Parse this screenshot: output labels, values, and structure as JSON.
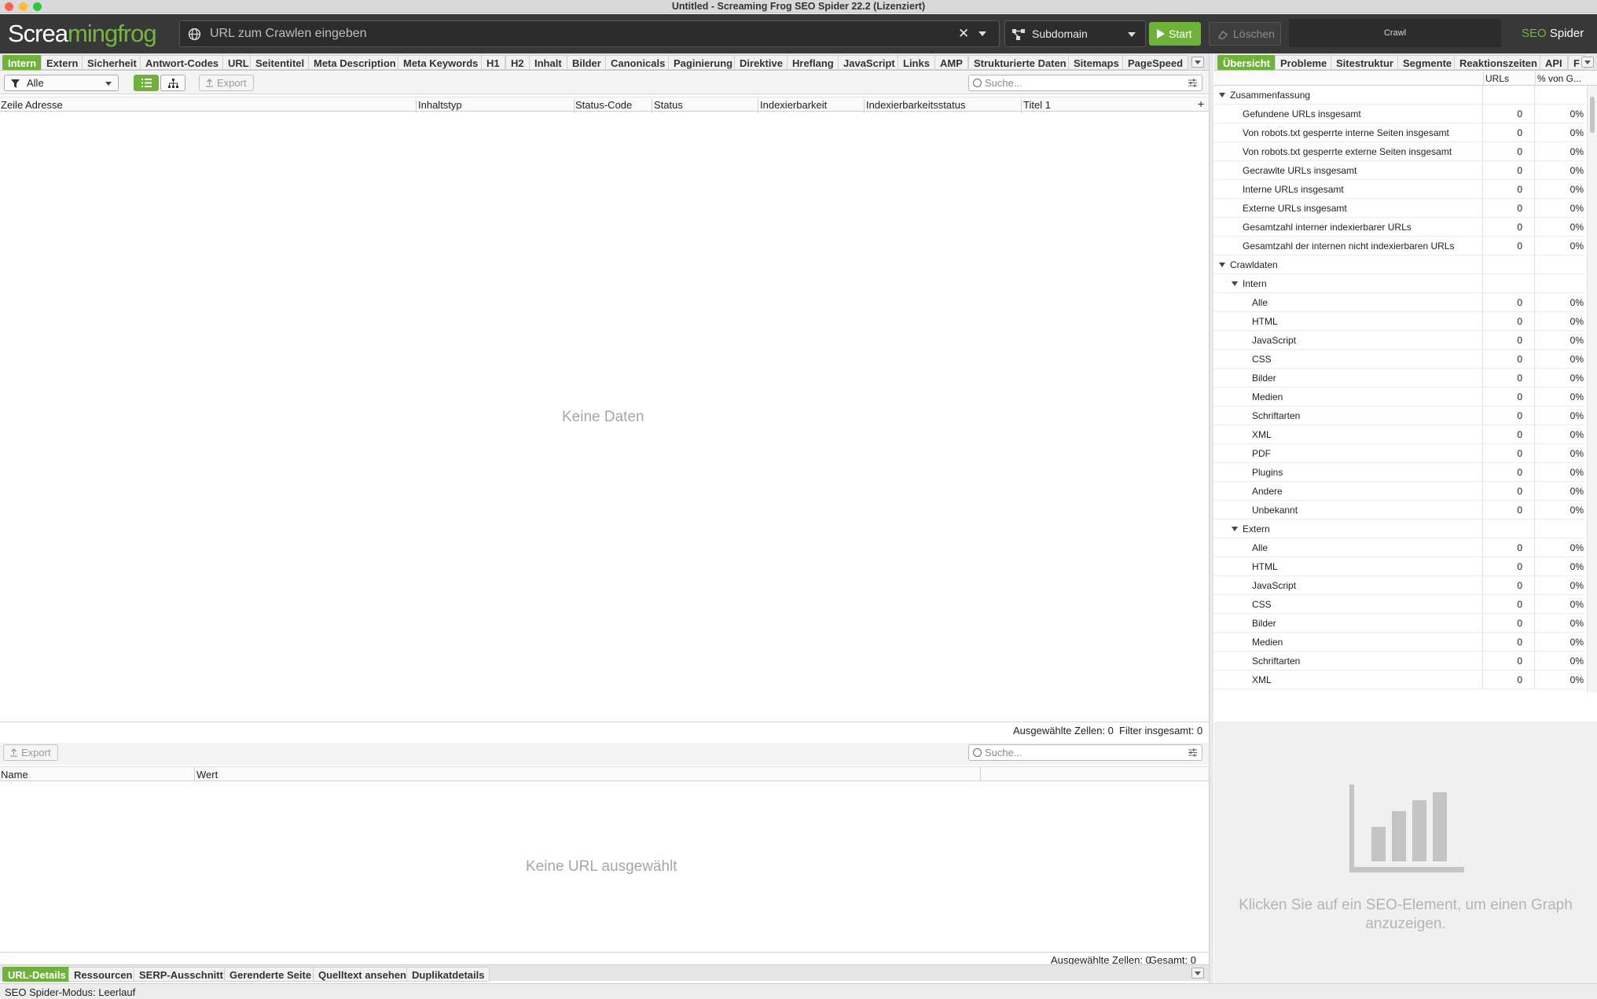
{
  "window": {
    "title": "Untitled - Screaming Frog SEO Spider 22.2 (Lizenziert)"
  },
  "toolbar": {
    "logo_part1": "Scre",
    "logo_part2": "mingfrog",
    "url_placeholder": "URL zum Crawlen eingeben",
    "mode_label": "Subdomain",
    "start_label": "Start",
    "clear_label": "Löschen",
    "crawl_label": "Crawl",
    "brand_seo": "SEO",
    "brand_spider": "Spider"
  },
  "main_tabs": [
    "Intern",
    "Extern",
    "Sicherheit",
    "Antwort-Codes",
    "URL",
    "Seitentitel",
    "Meta Description",
    "Meta Keywords",
    "H1",
    "H2",
    "Inhalt",
    "Bilder",
    "Canonicals",
    "Paginierung",
    "Direktive",
    "Hreflang",
    "JavaScript",
    "Links",
    "AMP",
    "Strukturierte Daten",
    "Sitemaps",
    "PageSpeed"
  ],
  "filter": {
    "selected": "Alle",
    "export_label": "Export",
    "search_placeholder": "Suche..."
  },
  "table": {
    "columns": [
      "Zeile",
      "Adresse",
      "Inhaltstyp",
      "Status-Code",
      "Status",
      "Indexierbarkeit",
      "Indexierbarkeitsstatus",
      "Titel 1"
    ],
    "empty_message": "Keine Daten"
  },
  "main_status": {
    "selected_cells": "Ausgewählte Zellen:  0",
    "filter_total": "Filter insgesamt:  0"
  },
  "lower": {
    "export_label": "Export",
    "search_placeholder": "Suche...",
    "columns": [
      "Name",
      "Wert"
    ],
    "empty_message": "Keine URL ausgewählt",
    "selected_cells": "Ausgewählte Zellen:  0",
    "total": "Gesamt:  0"
  },
  "bottom_tabs": [
    "URL-Details",
    "Ressourcen",
    "SERP-Ausschnitt",
    "Gerenderte Seite",
    "Quelltext ansehen",
    "Duplikatdetails"
  ],
  "status_line": "SEO Spider-Modus: Leerlauf",
  "right_tabs": [
    "Übersicht",
    "Probleme",
    "Sitestruktur",
    "Segmente",
    "Reaktionszeiten",
    "API",
    "F"
  ],
  "right_columns": {
    "urls": "URLs",
    "pct": "% von G..."
  },
  "right_rows": [
    {
      "label": "Zusammenfassung",
      "level": 0,
      "group": true
    },
    {
      "label": "Gefundene URLs insgesamt",
      "level": 1,
      "urls": "0",
      "pct": "0%"
    },
    {
      "label": "Von robots.txt gesperrte interne Seiten insgesamt",
      "level": 1,
      "urls": "0",
      "pct": "0%"
    },
    {
      "label": "Von robots.txt gesperrte externe Seiten insgesamt",
      "level": 1,
      "urls": "0",
      "pct": "0%"
    },
    {
      "label": "Gecrawlte URLs insgesamt",
      "level": 1,
      "urls": "0",
      "pct": "0%"
    },
    {
      "label": "Interne URLs insgesamt",
      "level": 1,
      "urls": "0",
      "pct": "0%"
    },
    {
      "label": "Externe URLs insgesamt",
      "level": 1,
      "urls": "0",
      "pct": "0%"
    },
    {
      "label": "Gesamtzahl interner indexierbarer URLs",
      "level": 1,
      "urls": "0",
      "pct": "0%"
    },
    {
      "label": "Gesamtzahl der internen nicht indexierbaren URLs",
      "level": 1,
      "urls": "0",
      "pct": "0%"
    },
    {
      "label": "Crawldaten",
      "level": 0,
      "group": true
    },
    {
      "label": "Intern",
      "level": 1,
      "group": true
    },
    {
      "label": "Alle",
      "level": 2,
      "urls": "0",
      "pct": "0%"
    },
    {
      "label": "HTML",
      "level": 2,
      "urls": "0",
      "pct": "0%"
    },
    {
      "label": "JavaScript",
      "level": 2,
      "urls": "0",
      "pct": "0%"
    },
    {
      "label": "CSS",
      "level": 2,
      "urls": "0",
      "pct": "0%"
    },
    {
      "label": "Bilder",
      "level": 2,
      "urls": "0",
      "pct": "0%"
    },
    {
      "label": "Medien",
      "level": 2,
      "urls": "0",
      "pct": "0%"
    },
    {
      "label": "Schriftarten",
      "level": 2,
      "urls": "0",
      "pct": "0%"
    },
    {
      "label": "XML",
      "level": 2,
      "urls": "0",
      "pct": "0%"
    },
    {
      "label": "PDF",
      "level": 2,
      "urls": "0",
      "pct": "0%"
    },
    {
      "label": "Plugins",
      "level": 2,
      "urls": "0",
      "pct": "0%"
    },
    {
      "label": "Andere",
      "level": 2,
      "urls": "0",
      "pct": "0%"
    },
    {
      "label": "Unbekannt",
      "level": 2,
      "urls": "0",
      "pct": "0%"
    },
    {
      "label": "Extern",
      "level": 1,
      "group": true
    },
    {
      "label": "Alle",
      "level": 2,
      "urls": "0",
      "pct": "0%"
    },
    {
      "label": "HTML",
      "level": 2,
      "urls": "0",
      "pct": "0%"
    },
    {
      "label": "JavaScript",
      "level": 2,
      "urls": "0",
      "pct": "0%"
    },
    {
      "label": "CSS",
      "level": 2,
      "urls": "0",
      "pct": "0%"
    },
    {
      "label": "Bilder",
      "level": 2,
      "urls": "0",
      "pct": "0%"
    },
    {
      "label": "Medien",
      "level": 2,
      "urls": "0",
      "pct": "0%"
    },
    {
      "label": "Schriftarten",
      "level": 2,
      "urls": "0",
      "pct": "0%"
    },
    {
      "label": "XML",
      "level": 2,
      "urls": "0",
      "pct": "0%"
    }
  ],
  "graph_message": "Klicken Sie auf ein SEO-Element, um einen Graph anzuzeigen.",
  "colors": {
    "accent": "#6fb23a",
    "toolbar_bg": "#383838"
  }
}
